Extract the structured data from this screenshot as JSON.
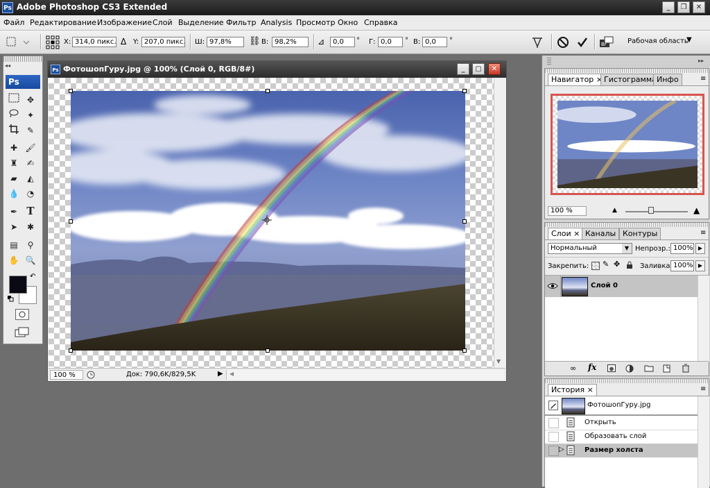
{
  "app": {
    "title": "Adobe Photoshop CS3 Extended",
    "logo": "Ps",
    "window_buttons": [
      "_",
      "❐",
      "✕"
    ]
  },
  "menu": [
    "Файл",
    "Редактирование",
    "Изображение",
    "Слой",
    "Выделение",
    "Фильтр",
    "Analysis",
    "Просмотр",
    "Окно",
    "Справка"
  ],
  "options": {
    "x_label": "X:",
    "x_value": "314,0 пикс.",
    "y_label": "Y:",
    "y_value": "207,0 пикс.",
    "w_label": "Ш:",
    "w_value": "97,8%",
    "h_label": "В:",
    "h_value": "98,2%",
    "rot_value": "0,0",
    "deg": "°",
    "hskew_label": "Г:",
    "hskew_value": "0,0",
    "vskew_label": "В:",
    "vskew_value": "0,0",
    "workspace": "Рабочая область",
    "cancel_icon": "cancel-icon",
    "commit_icon": "commit-checkmark-icon"
  },
  "tools": {
    "logo": "Ps",
    "foreground_color": "#0a0a14",
    "background_color": "#ffffff"
  },
  "document": {
    "title": "ФотошопГуру.jpg @ 100% (Слой 0, RGB/8#)",
    "logo": "Ps",
    "zoom": "100 %",
    "doc_info": "Док: 790,6K/829,5K"
  },
  "navigator": {
    "tabs": [
      "Навигатор",
      "Гистограмма",
      "Инфо"
    ],
    "zoom": "100 %",
    "frame_color": "#d9534f"
  },
  "layers": {
    "tabs": [
      "Слои",
      "Каналы",
      "Контуры"
    ],
    "blend_mode": "Нормальный",
    "opacity_label": "Непрозр.:",
    "opacity_value": "100%",
    "lock_label": "Закрепить:",
    "fill_label": "Заливка:",
    "fill_value": "100%",
    "items": [
      {
        "name": "Слой 0"
      }
    ],
    "footer_icons": [
      "link-icon",
      "fx-icon",
      "mask-icon",
      "adjustment-icon",
      "folder-icon",
      "new-layer-icon",
      "trash-icon"
    ]
  },
  "history": {
    "tabs": [
      "История"
    ],
    "snapshot": "ФотошопГуру.jpg",
    "items": [
      {
        "label": "Открыть",
        "active": false
      },
      {
        "label": "Образовать слой",
        "active": false
      },
      {
        "label": "Размер холста",
        "active": true
      }
    ]
  }
}
